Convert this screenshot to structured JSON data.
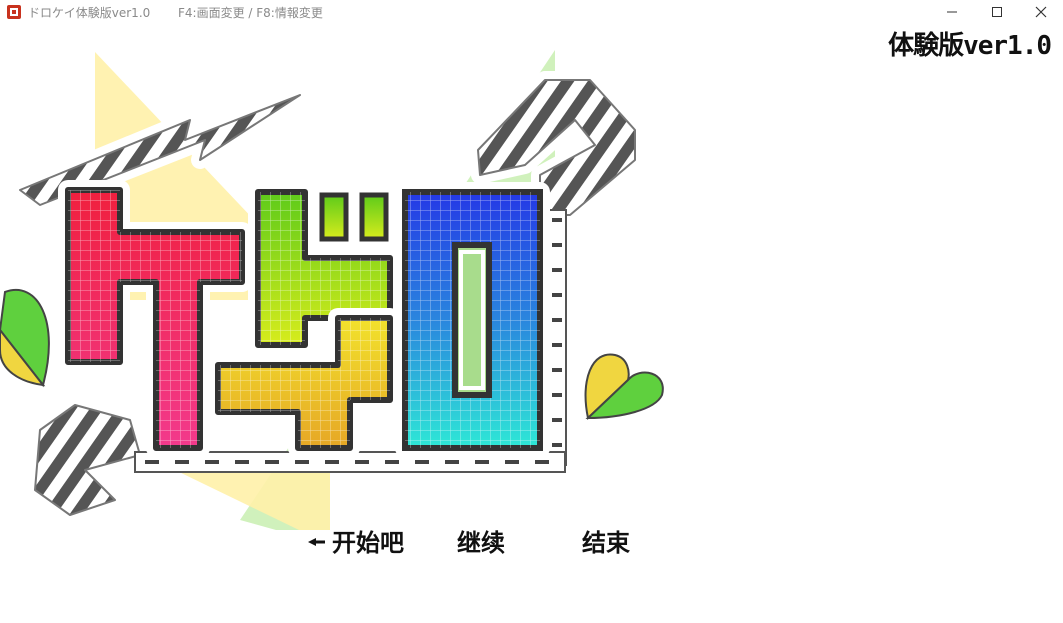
{
  "window": {
    "title": "ドロケイ体験版ver1.0",
    "hint": "F4:画面変更 / F8:情報変更",
    "icon": "app-icon",
    "controls": [
      "minimize-icon",
      "maximize-icon",
      "close-icon"
    ]
  },
  "version_label": "体験版ver1.0",
  "logo": {
    "icon": "dorokei-logo",
    "colors": {
      "red": "#f0204a",
      "green": "#86d61e",
      "yellow": "#eccd2a",
      "blue": "#2a4ee8",
      "cyan": "#2ee6da",
      "stripe": "#555555"
    }
  },
  "menu": {
    "items": [
      {
        "label": "开始吧",
        "selected": true
      },
      {
        "label": "继续",
        "selected": false
      },
      {
        "label": "结束",
        "selected": false
      }
    ],
    "cursor_icon": "pointer-arrow-icon"
  }
}
